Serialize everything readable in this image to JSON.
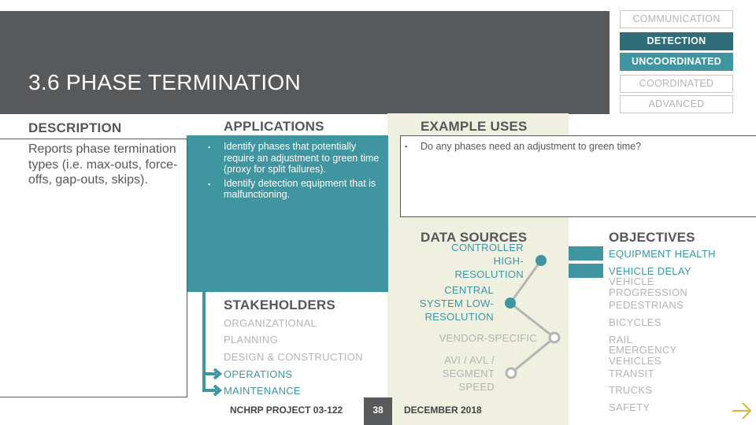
{
  "header": {
    "title": "3.6 PHASE TERMINATION"
  },
  "nav_tabs": [
    {
      "label": "COMMUNICATION",
      "state": "inactive"
    },
    {
      "label": "DETECTION",
      "state": "selected-parent"
    },
    {
      "label": "UNCOORDINATED",
      "state": "selected"
    },
    {
      "label": "COORDINATED",
      "state": "inactive"
    },
    {
      "label": "ADVANCED",
      "state": "inactive"
    }
  ],
  "description": {
    "heading": "DESCRIPTION",
    "text": "Reports phase termination types (i.e. max-outs, force-offs, gap-outs, skips)."
  },
  "applications": {
    "heading": "APPLICATIONS",
    "items": [
      "Identify phases that potentially require an adjustment to green time (proxy for split failures).",
      "Identify detection equipment that is malfunctioning."
    ]
  },
  "example_uses": {
    "heading": "EXAMPLE USES",
    "items": [
      "Do any phases need an adjustment to green time?"
    ]
  },
  "stakeholders": {
    "heading": "STAKEHOLDERS",
    "items": [
      {
        "label": "ORGANIZATIONAL",
        "active": false
      },
      {
        "label": "PLANNING",
        "active": false
      },
      {
        "label": "DESIGN & CONSTRUCTION",
        "active": false
      },
      {
        "label": "OPERATIONS",
        "active": true
      },
      {
        "label": "MAINTENANCE",
        "active": true
      }
    ]
  },
  "data_sources": {
    "heading": "DATA SOURCES",
    "items": [
      {
        "label": "CONTROLLER HIGH-RESOLUTION",
        "lines": [
          "CONTROLLER",
          "HIGH-",
          "RESOLUTION"
        ],
        "active": true
      },
      {
        "label": "CENTRAL SYSTEM LOW-RESOLUTION",
        "lines": [
          "CENTRAL",
          "SYSTEM LOW-",
          "RESOLUTION"
        ],
        "active": true
      },
      {
        "label": "VENDOR-SPECIFIC",
        "lines": [
          "VENDOR-SPECIFIC"
        ],
        "active": false
      },
      {
        "label": "AVI / AVL / SEGMENT SPEED",
        "lines": [
          "AVI / AVL /",
          "SEGMENT",
          "SPEED"
        ],
        "active": false
      }
    ]
  },
  "objectives": {
    "heading": "OBJECTIVES",
    "items": [
      {
        "label": "EQUIPMENT HEALTH",
        "active": true
      },
      {
        "label": "VEHICLE DELAY",
        "active": true
      },
      {
        "label": "VEHICLE PROGRESSION",
        "lines": [
          "VEHICLE",
          "PROGRESSION"
        ],
        "active": false
      },
      {
        "label": "PEDESTRIANS",
        "active": false
      },
      {
        "label": "BICYCLES",
        "active": false
      },
      {
        "label": "RAIL",
        "active": false
      },
      {
        "label": "EMERGENCY VEHICLES",
        "lines": [
          "EMERGENCY",
          "VEHICLES"
        ],
        "active": false
      },
      {
        "label": "TRANSIT",
        "active": false
      },
      {
        "label": "TRUCKS",
        "active": false
      },
      {
        "label": "SAFETY",
        "active": false
      }
    ]
  },
  "footer": {
    "project": "NCHRP PROJECT 03-122",
    "page_number": "38",
    "date": "DECEMBER 2018",
    "next_icon": "arrow-right-icon"
  },
  "colors": {
    "header_gray": "#58595b",
    "teal": "#3f96a1",
    "dark_teal": "#2f6d78",
    "cream": "#eff0e0",
    "inactive_gray": "#b4b4b4",
    "arrow_gold": "#d9b441"
  }
}
